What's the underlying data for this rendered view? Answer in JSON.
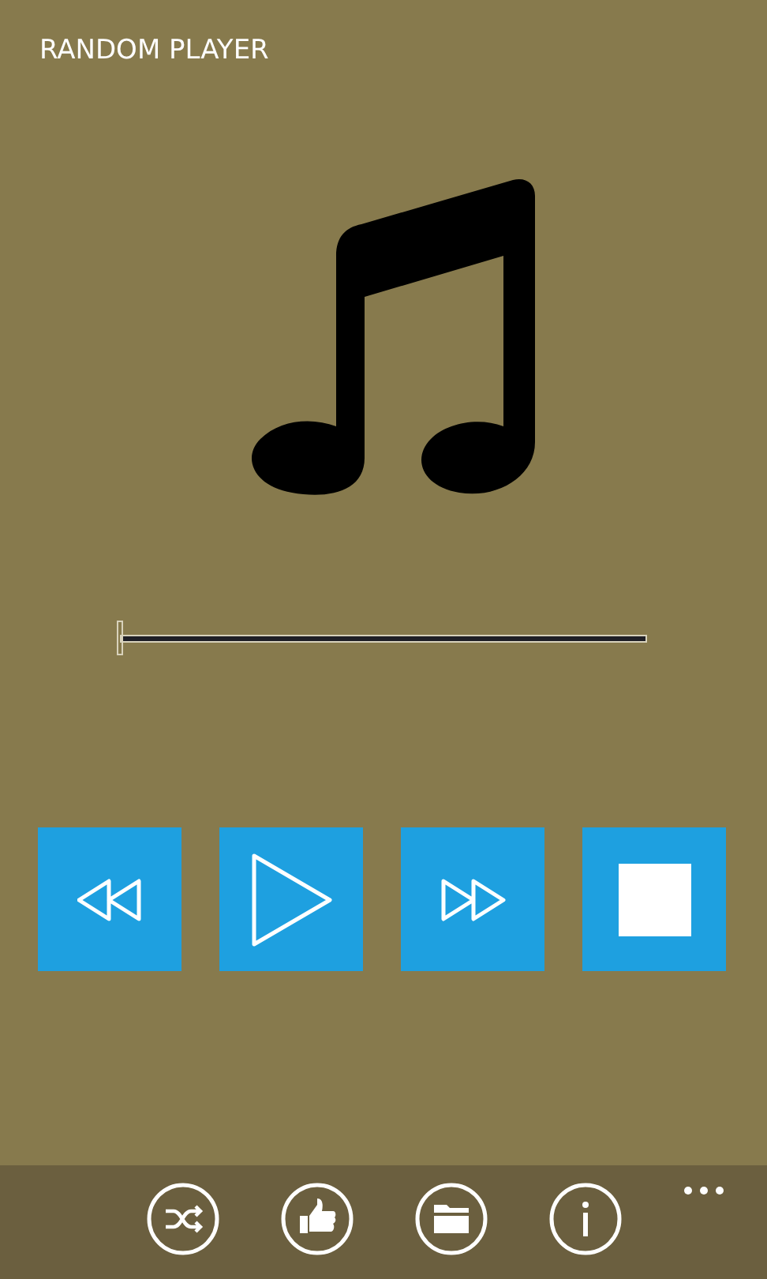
{
  "title": "RANDOM PLAYER",
  "progress": {
    "level": 0
  },
  "controls": [
    {
      "kind": "rewind"
    },
    {
      "kind": "play"
    },
    {
      "kind": "forward"
    },
    {
      "kind": "stop"
    }
  ],
  "app_bar": {
    "buttons": [
      {
        "kind": "shuffle"
      },
      {
        "kind": "like"
      },
      {
        "kind": "folder"
      },
      {
        "kind": "info"
      }
    ]
  }
}
